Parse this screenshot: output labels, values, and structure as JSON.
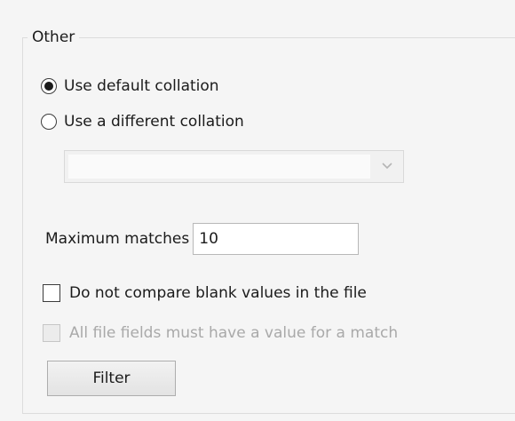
{
  "group": {
    "title": "Other"
  },
  "collation": {
    "default_label": "Use default collation",
    "different_label": "Use a different collation",
    "selected": "default",
    "dropdown_value": "",
    "dropdown_icon": "chevron-down-icon"
  },
  "matches": {
    "label": "Maximum matches",
    "value": "10"
  },
  "options": {
    "blank_values_label": "Do not compare blank values in the file",
    "blank_values_checked": false,
    "all_fields_label": "All file fields must have a value for a match",
    "all_fields_checked": false,
    "all_fields_enabled": false
  },
  "actions": {
    "filter_label": "Filter"
  },
  "colors": {
    "background": "#f5f5f5",
    "border": "#dcdcdc",
    "disabled_text": "#a9a9a9"
  }
}
